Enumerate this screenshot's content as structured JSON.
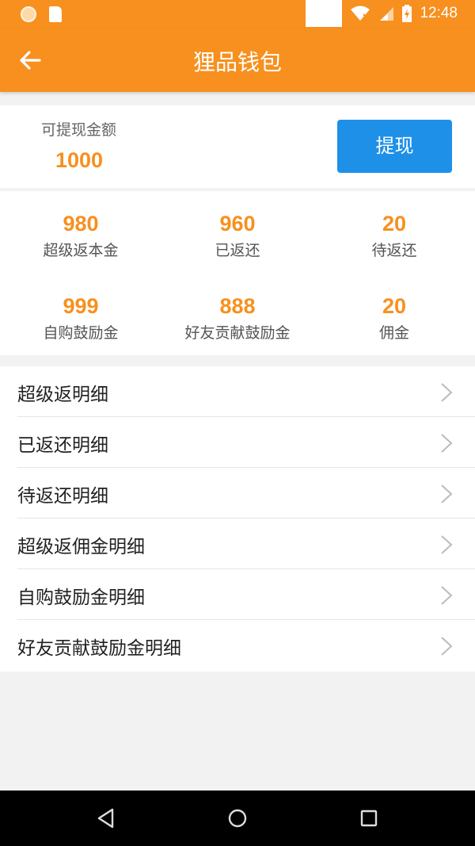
{
  "status_bar": {
    "time": "12:48"
  },
  "app_bar": {
    "title": "狸品钱包"
  },
  "balance": {
    "label": "可提现金额",
    "value": "1000",
    "withdraw_label": "提现"
  },
  "stats": [
    {
      "value": "980",
      "label": "超级返本金"
    },
    {
      "value": "960",
      "label": "已返还"
    },
    {
      "value": "20",
      "label": "待返还"
    },
    {
      "value": "999",
      "label": "自购鼓励金"
    },
    {
      "value": "888",
      "label": "好友贡献鼓励金"
    },
    {
      "value": "20",
      "label": "佣金"
    }
  ],
  "menu": [
    {
      "label": "超级返明细"
    },
    {
      "label": "已返还明细"
    },
    {
      "label": "待返还明细"
    },
    {
      "label": "超级返佣金明细"
    },
    {
      "label": "自购鼓励金明细"
    },
    {
      "label": "好友贡献鼓励金明细"
    }
  ],
  "colors": {
    "accent": "#f7901e",
    "button_blue": "#1e90e8"
  }
}
